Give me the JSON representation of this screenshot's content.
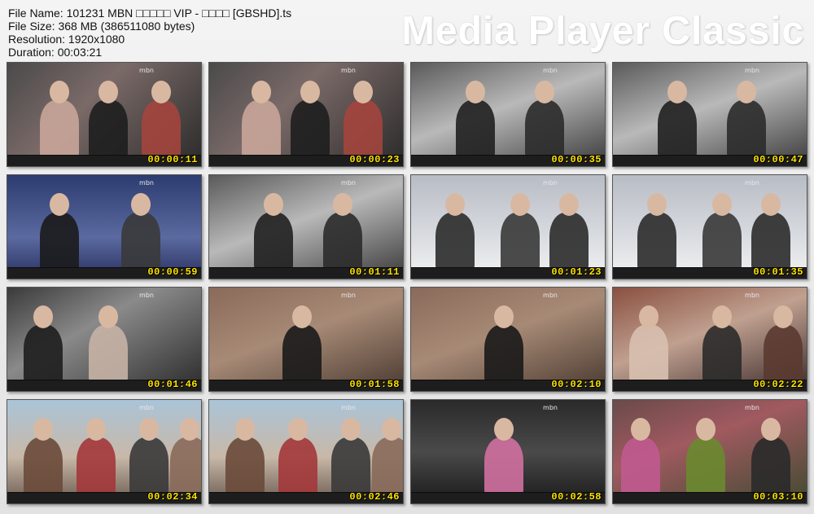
{
  "info": {
    "file_name": "File Name: 101231 MBN □□□□□ VIP - □□□□ [GBSHD].ts",
    "file_size": "File Size: 368 MB (386511080 bytes)",
    "resolution": "Resolution: 1920x1080",
    "duration": "Duration: 00:03:21"
  },
  "brand": "Media Player Classic",
  "channel_logo": "mbn",
  "thumbnails": [
    {
      "time": "00:00:11",
      "scene": "stage"
    },
    {
      "time": "00:00:23",
      "scene": "stage"
    },
    {
      "time": "00:00:35",
      "scene": "poster"
    },
    {
      "time": "00:00:47",
      "scene": "poster"
    },
    {
      "time": "00:00:59",
      "scene": "blue"
    },
    {
      "time": "00:01:11",
      "scene": "poster"
    },
    {
      "time": "00:01:23",
      "scene": "snow"
    },
    {
      "time": "00:01:35",
      "scene": "snow"
    },
    {
      "time": "00:01:46",
      "scene": "dark"
    },
    {
      "time": "00:01:58",
      "scene": "closeup"
    },
    {
      "time": "00:02:10",
      "scene": "closeup"
    },
    {
      "time": "00:02:22",
      "scene": "warm"
    },
    {
      "time": "00:02:34",
      "scene": "group"
    },
    {
      "time": "00:02:46",
      "scene": "group"
    },
    {
      "time": "00:02:58",
      "scene": "concert"
    },
    {
      "time": "00:03:10",
      "scene": "fade"
    }
  ]
}
